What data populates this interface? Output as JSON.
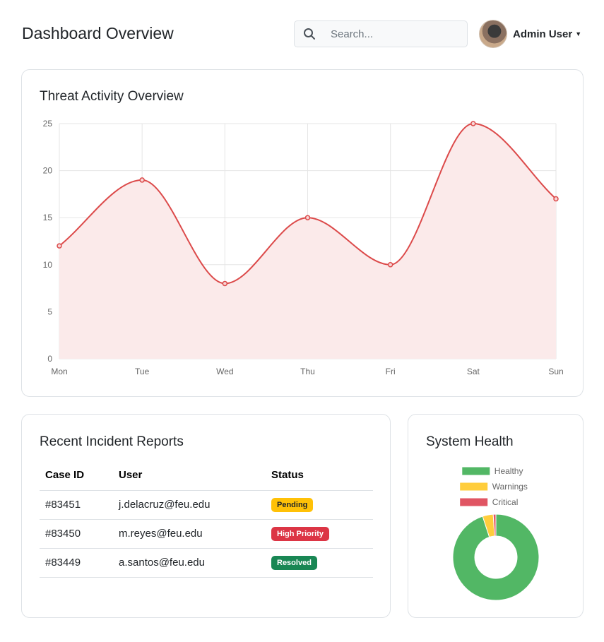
{
  "header": {
    "title": "Dashboard Overview",
    "search_placeholder": "Search...",
    "user_name": "Admin User"
  },
  "threat_card": {
    "title": "Threat Activity Overview"
  },
  "chart_data": {
    "type": "line",
    "title": "Threat Activity Overview",
    "categories": [
      "Mon",
      "Tue",
      "Wed",
      "Thu",
      "Fri",
      "Sat",
      "Sun"
    ],
    "series": [
      {
        "values": [
          12,
          19,
          8,
          15,
          10,
          25,
          17
        ]
      }
    ],
    "ylim": [
      0,
      25
    ],
    "yticks": [
      0,
      5,
      10,
      15,
      20,
      25
    ],
    "grid": true,
    "curve": "smooth",
    "fill": true,
    "colors": {
      "line": "#dc4a4a",
      "fill": "#fbeaea"
    }
  },
  "incidents": {
    "title": "Recent Incident Reports",
    "columns": [
      "Case ID",
      "User",
      "Status"
    ],
    "rows": [
      {
        "case_id": "#83451",
        "user": "j.delacruz@feu.edu",
        "status": "Pending"
      },
      {
        "case_id": "#83450",
        "user": "m.reyes@feu.edu",
        "status": "High Priority"
      },
      {
        "case_id": "#83449",
        "user": "a.santos@feu.edu",
        "status": "Resolved"
      }
    ],
    "status_colors": {
      "Pending": "#ffc107",
      "High Priority": "#dc3545",
      "Resolved": "#198754"
    }
  },
  "system_health": {
    "title": "System Health",
    "chart_data": {
      "type": "pie",
      "categories": [
        "Healthy",
        "Warnings",
        "Critical"
      ],
      "values": [
        95,
        4,
        1
      ],
      "colors": [
        "#52b765",
        "#ffcd3c",
        "#e05563"
      ],
      "legend": "top"
    }
  }
}
